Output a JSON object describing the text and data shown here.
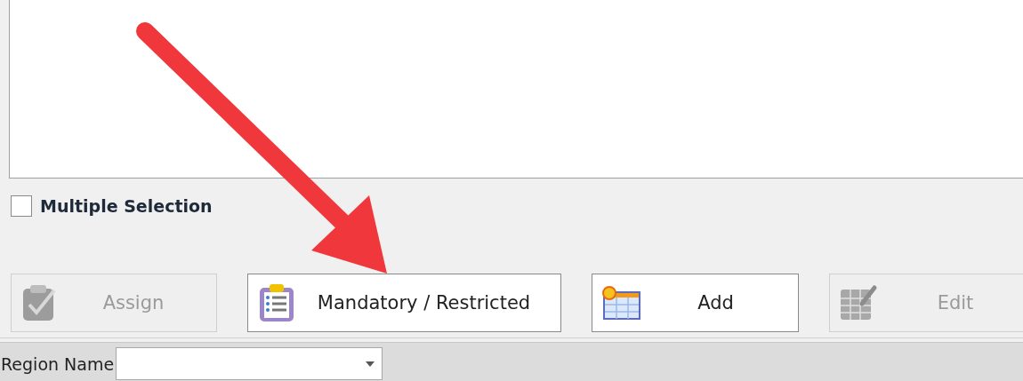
{
  "multiple_selection": {
    "label": "Multiple Selection",
    "checked": false
  },
  "buttons": [
    {
      "label": "Assign",
      "kind": "assign",
      "disabled": true
    },
    {
      "label": "Mandatory / Restricted",
      "kind": "mandatory",
      "disabled": false
    },
    {
      "label": "Add",
      "kind": "add",
      "disabled": false
    },
    {
      "label": "Edit",
      "kind": "edit",
      "disabled": true
    }
  ],
  "filter_bar": {
    "label": "Region Name"
  }
}
